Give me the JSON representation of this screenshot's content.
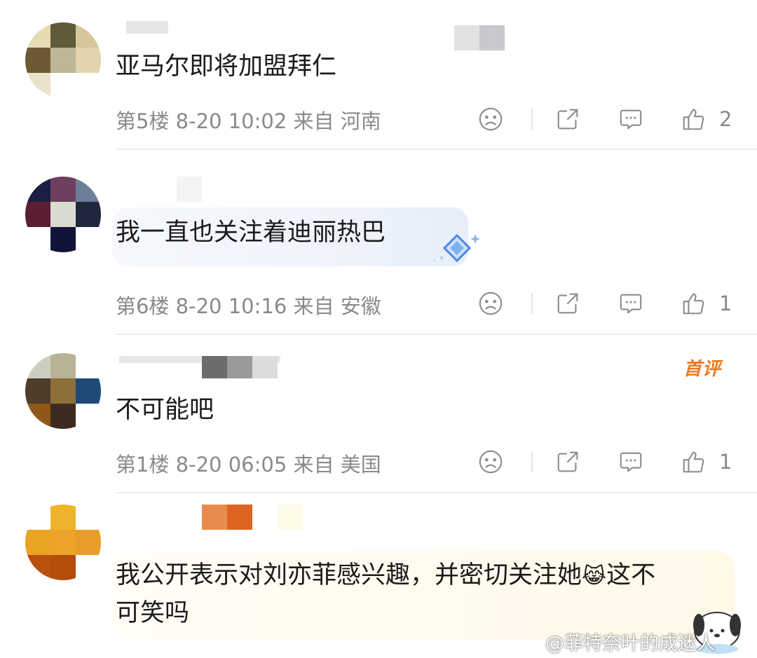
{
  "comments": [
    {
      "text": "亚马尔即将加盟拜仁",
      "meta": "第5楼 8-20 10:02 来自 河南",
      "likes": "2",
      "avatar_colors": [
        "#e6dcb4",
        "#5f5a38",
        "#d6c69c",
        "#6b5a34",
        "#bdb798",
        "#e2d4ac",
        "#e9e3cc",
        "#ffffff",
        "#ffffff"
      ]
    },
    {
      "text": "我一直也关注着迪丽热巴",
      "meta": "第6楼 8-20 10:16 来自 安徽",
      "likes": "1",
      "avatar_colors": [
        "#1c1f45",
        "#6f3f5f",
        "#6e7f99",
        "#5b1e35",
        "#d9dbd0",
        "#20263c",
        "#ffffff",
        "#11143a",
        "#ffffff"
      ]
    },
    {
      "text": "不可能吧",
      "meta": "第1楼 8-20 06:05 来自 美国",
      "likes": "1",
      "badge": "首评",
      "avatar_colors": [
        "#cccfc0",
        "#b8b297",
        "#ffffff",
        "#4d3d2a",
        "#8d6f3a",
        "#1f4a78",
        "#8f5818",
        "#3f2a21",
        "#ffffff"
      ]
    },
    {
      "text_line1": "我公开表示对刘亦菲感兴趣，并密切关注她",
      "emoji": "😹",
      "text_line1_end": "这不",
      "text_line2": "可笑吗",
      "avatar_colors": [
        "#ffffff",
        "#edb32c",
        "#ffffff",
        "#e9a424",
        "#eba32a",
        "#e89d2a",
        "#b8500e",
        "#b44d0c",
        "#ffffff"
      ]
    }
  ],
  "watermark": "@菲特奈叶的成迷人",
  "colors": {
    "badge": "#ec7a24",
    "meta_text": "#8a8a8a"
  }
}
